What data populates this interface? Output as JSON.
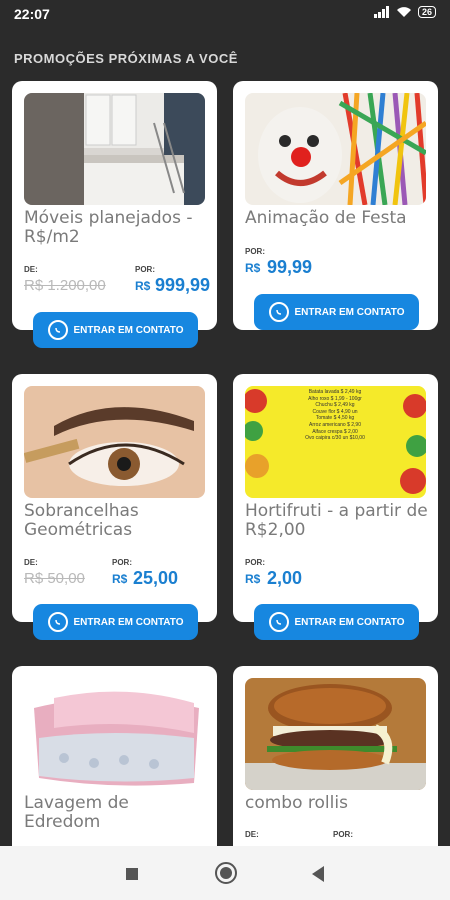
{
  "status_bar": {
    "time": "22:07",
    "battery": "26",
    "icons": [
      "signal-icon",
      "wifi-icon",
      "battery-icon"
    ]
  },
  "section_title": "PROMOÇÕES PRÓXIMAS A VOCÊ",
  "cards": [
    {
      "title": "Móveis planejados - R$/m2",
      "de_label": "DE:",
      "old_price": "R$ 1.200,00",
      "por_label": "POR:",
      "currency": "R$",
      "price": "999,99",
      "button": "ENTRAR EM CONTATO",
      "image": "furniture-room"
    },
    {
      "title": "Animação de Festa",
      "de_label": "",
      "old_price": "",
      "por_label": "POR:",
      "currency": "R$",
      "price": "99,99",
      "button": "ENTRAR EM CONTATO",
      "image": "clown-party"
    },
    {
      "title": "Sobrancelhas Geométricas",
      "de_label": "DE:",
      "old_price": "R$ 50,00",
      "por_label": "POR:",
      "currency": "R$",
      "price": "25,00",
      "button": "ENTRAR EM CONTATO",
      "image": "eyebrow"
    },
    {
      "title": "Hortifruti - a partir de R$2,00",
      "de_label": "",
      "old_price": "",
      "por_label": "POR:",
      "currency": "R$",
      "price": "2,00",
      "button": "ENTRAR EM CONTATO",
      "image": "produce-flyer",
      "flyer_text": "Batata lavada $ 2,49 kg\nAlho roxo $ 1,99 - 100gr\nChuchu $ 2,49 kg\nCouve flor $ 4,90 un\nTomate $ 4,50 kg\nArroz americano $ 2,90\nAlface crespa $ 2,00\nOvo caipira c/30 un $10,00"
    },
    {
      "title": "Lavagem de Edredom",
      "image": "duvet"
    },
    {
      "title": "combo rollis",
      "de_label": "DE:",
      "por_label": "POR:",
      "image": "burger"
    }
  ],
  "colors": {
    "accent": "#1787e0",
    "price": "#1a7fd0",
    "background": "#2b2b2b"
  },
  "nav": [
    "recent-apps-button",
    "home-button",
    "back-button"
  ]
}
